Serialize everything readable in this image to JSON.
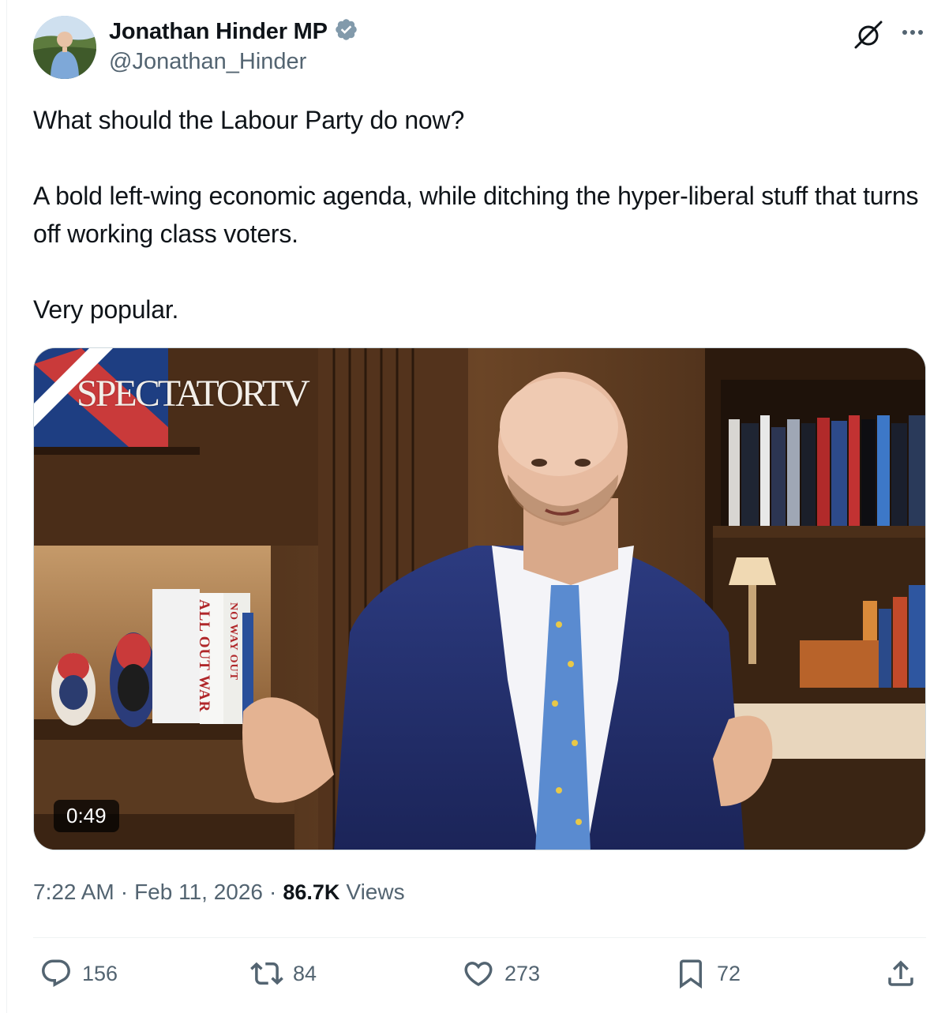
{
  "author": {
    "display_name": "Jonathan Hinder MP",
    "handle": "@Jonathan_Hinder"
  },
  "tweet": {
    "lines": [
      "What should the Labour Party do now?",
      "A bold left-wing economic agenda, while ditching the hyper-liberal stuff that turns off working class voters.",
      "Very popular."
    ]
  },
  "media": {
    "watermark": "SPECTATORTV",
    "duration": "0:49",
    "book_titles": [
      "ALL OUT WAR",
      "NO WAY OUT"
    ]
  },
  "meta": {
    "time": "7:22 AM",
    "separator": "·",
    "date": "Feb 11, 2026",
    "views_count": "86.7K",
    "views_label": "Views"
  },
  "actions": {
    "replies": "156",
    "reposts": "84",
    "likes": "273",
    "bookmarks": "72"
  },
  "colors": {
    "text": "#0f1419",
    "secondary": "#536471",
    "verified_badge": "#829aab"
  }
}
